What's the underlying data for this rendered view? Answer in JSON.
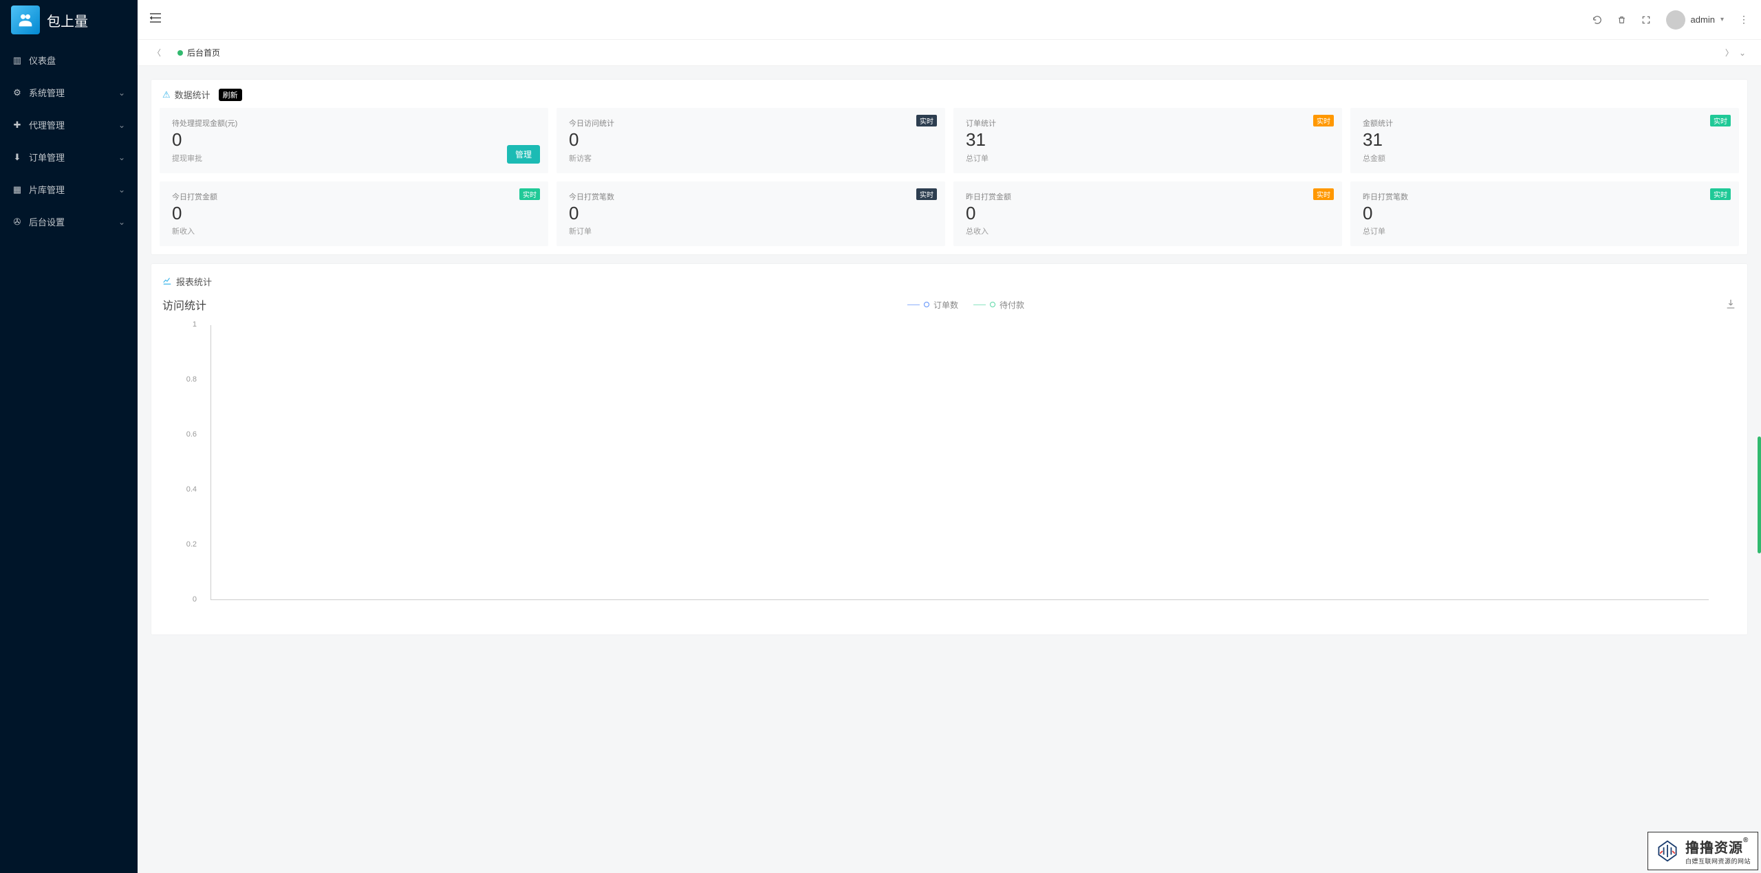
{
  "brand": {
    "name": "包上量"
  },
  "sidebar": {
    "items": [
      {
        "label": "仪表盘",
        "icon": "dashboard"
      },
      {
        "label": "系统管理",
        "icon": "gear",
        "expandable": true
      },
      {
        "label": "代理管理",
        "icon": "plus-box",
        "expandable": true
      },
      {
        "label": "订单管理",
        "icon": "download",
        "expandable": true
      },
      {
        "label": "片库管理",
        "icon": "grid",
        "expandable": true
      },
      {
        "label": "后台设置",
        "icon": "settings",
        "expandable": true
      }
    ]
  },
  "topbar": {
    "username": "admin"
  },
  "tabs": [
    {
      "label": "后台首页",
      "active": true
    }
  ],
  "stats": {
    "heading": "数据统计",
    "refresh_label": "刷新",
    "cards_row1": [
      {
        "title": "待处理提现金额(元)",
        "value": "0",
        "sub": "提现审批",
        "manage_label": "管理"
      },
      {
        "title": "今日访问统计",
        "value": "0",
        "sub": "新访客",
        "badge": "实时",
        "badge_cls": "badge-blue"
      },
      {
        "title": "订单统计",
        "value": "31",
        "sub": "总订单",
        "badge": "实时",
        "badge_cls": "badge-orange"
      },
      {
        "title": "金额统计",
        "value": "31",
        "sub": "总金额",
        "badge": "实时",
        "badge_cls": "badge-green"
      }
    ],
    "cards_row2": [
      {
        "title": "今日打赏金额",
        "value": "0",
        "sub": "新收入",
        "badge": "实时",
        "badge_cls": "badge-green"
      },
      {
        "title": "今日打赏笔数",
        "value": "0",
        "sub": "新订单",
        "badge": "实时",
        "badge_cls": "badge-blue"
      },
      {
        "title": "昨日打赏金额",
        "value": "0",
        "sub": "总收入",
        "badge": "实时",
        "badge_cls": "badge-orange"
      },
      {
        "title": "昨日打赏笔数",
        "value": "0",
        "sub": "总订单",
        "badge": "实时",
        "badge_cls": "badge-green"
      }
    ]
  },
  "report": {
    "heading": "报表统计",
    "chart_title": "访问统计",
    "legend": [
      {
        "label": "订单数",
        "color": "#5b8ff9"
      },
      {
        "label": "待付款",
        "color": "#5ad8a6"
      }
    ]
  },
  "chart_data": {
    "type": "line",
    "title": "访问统计",
    "ylabel": "",
    "xlabel": "",
    "ylim": [
      0,
      1
    ],
    "y_ticks": [
      "0",
      "0.2",
      "0.4",
      "0.6",
      "0.8",
      "1"
    ],
    "series": [
      {
        "name": "订单数",
        "values": []
      },
      {
        "name": "待付款",
        "values": []
      }
    ],
    "categories": []
  },
  "watermark": {
    "line1": "撸撸资源",
    "reg": "®",
    "line2": "白嫖互联网资源的网站"
  }
}
